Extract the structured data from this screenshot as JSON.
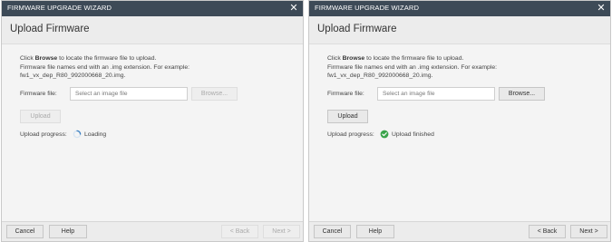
{
  "dialogs": [
    {
      "title": "FIRMWARE UPGRADE WIZARD",
      "close_glyph": "✕",
      "header": "Upload Firmware",
      "instructions": {
        "line1_before": "Click ",
        "line1_bold": "Browse",
        "line1_after": " to locate the firmware file to upload.",
        "line2": "Firmware file names end with an .img extension. For example:",
        "line3": "fw1_vx_dep_R80_992000668_20.img."
      },
      "firmware_label": "Firmware file:",
      "firmware_placeholder": "Select an image file",
      "browse_label": "Browse...",
      "upload_label": "Upload",
      "progress_label": "Upload progress:",
      "status_icon": "spinner-icon",
      "status_text": "Loading",
      "buttons": {
        "cancel": "Cancel",
        "help": "Help",
        "back": "< Back",
        "next": "Next >"
      }
    },
    {
      "title": "FIRMWARE UPGRADE WIZARD",
      "close_glyph": "✕",
      "header": "Upload Firmware",
      "instructions": {
        "line1_before": "Click ",
        "line1_bold": "Browse",
        "line1_after": " to locate the firmware file to upload.",
        "line2": "Firmware file names end with an .img extension. For example:",
        "line3": "fw1_vx_dep_R80_992000668_20.img."
      },
      "firmware_label": "Firmware file:",
      "firmware_placeholder": "Select an image file",
      "browse_label": "Browse...",
      "upload_label": "Upload",
      "progress_label": "Upload progress:",
      "status_icon": "check-circle-icon",
      "status_text": "Upload finished",
      "buttons": {
        "cancel": "Cancel",
        "help": "Help",
        "back": "< Back",
        "next": "Next >"
      }
    }
  ],
  "colors": {
    "titlebar": "#3d4a57",
    "spinner": "#3a7fc1",
    "success": "#3aa34a"
  }
}
